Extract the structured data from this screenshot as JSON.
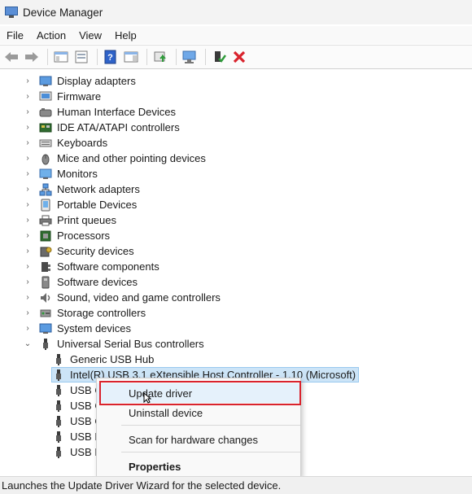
{
  "window": {
    "title": "Device Manager"
  },
  "menu": [
    "File",
    "Action",
    "View",
    "Help"
  ],
  "toolbar_icons": [
    "back-arrow-icon",
    "forward-arrow-icon",
    "show-hide-console-tree-icon",
    "properties-icon",
    "help-icon",
    "action-pane-icon",
    "update-driver-icon",
    "scan-hardware-icon",
    "enable-device-icon",
    "uninstall-device-icon"
  ],
  "tree": {
    "categories": [
      {
        "label": "Display adapters",
        "icon": "display-adapter-icon",
        "expanded": false
      },
      {
        "label": "Firmware",
        "icon": "firmware-icon",
        "expanded": false
      },
      {
        "label": "Human Interface Devices",
        "icon": "hid-icon",
        "expanded": false
      },
      {
        "label": "IDE ATA/ATAPI controllers",
        "icon": "ide-controller-icon",
        "expanded": false
      },
      {
        "label": "Keyboards",
        "icon": "keyboard-icon",
        "expanded": false
      },
      {
        "label": "Mice and other pointing devices",
        "icon": "mouse-icon",
        "expanded": false
      },
      {
        "label": "Monitors",
        "icon": "monitor-icon",
        "expanded": false
      },
      {
        "label": "Network adapters",
        "icon": "network-adapter-icon",
        "expanded": false
      },
      {
        "label": "Portable Devices",
        "icon": "portable-device-icon",
        "expanded": false
      },
      {
        "label": "Print queues",
        "icon": "printer-icon",
        "expanded": false
      },
      {
        "label": "Processors",
        "icon": "processor-icon",
        "expanded": false
      },
      {
        "label": "Security devices",
        "icon": "security-device-icon",
        "expanded": false
      },
      {
        "label": "Software components",
        "icon": "software-component-icon",
        "expanded": false
      },
      {
        "label": "Software devices",
        "icon": "software-device-icon",
        "expanded": false
      },
      {
        "label": "Sound, video and game controllers",
        "icon": "sound-icon",
        "expanded": false
      },
      {
        "label": "Storage controllers",
        "icon": "storage-controller-icon",
        "expanded": false
      },
      {
        "label": "System devices",
        "icon": "system-device-icon",
        "expanded": false
      },
      {
        "label": "Universal Serial Bus controllers",
        "icon": "usb-icon",
        "expanded": true
      }
    ],
    "usb_children": [
      {
        "label": "Generic USB Hub",
        "selected": false
      },
      {
        "label": "Intel(R) USB 3.1 eXtensible Host Controller - 1.10 (Microsoft)",
        "selected": true
      },
      {
        "label": "USB C",
        "selected": false
      },
      {
        "label": "USB C",
        "selected": false
      },
      {
        "label": "USB C",
        "selected": false
      },
      {
        "label": "USB N",
        "selected": false
      },
      {
        "label": "USB R",
        "selected": false
      }
    ]
  },
  "context_menu": {
    "items": [
      {
        "label": "Update driver",
        "bold": false,
        "highlighted": true
      },
      {
        "label": "Uninstall device",
        "bold": false,
        "highlighted": false
      },
      {
        "label": "Scan for hardware changes",
        "bold": false,
        "highlighted": false
      },
      {
        "label": "Properties",
        "bold": true,
        "highlighted": false
      }
    ]
  },
  "status": {
    "text": "Launches the Update Driver Wizard for the selected device."
  },
  "colors": {
    "selection": "#cce4f7",
    "highlight_box": "#d9232d",
    "uninstall_red": "#d9232d"
  }
}
